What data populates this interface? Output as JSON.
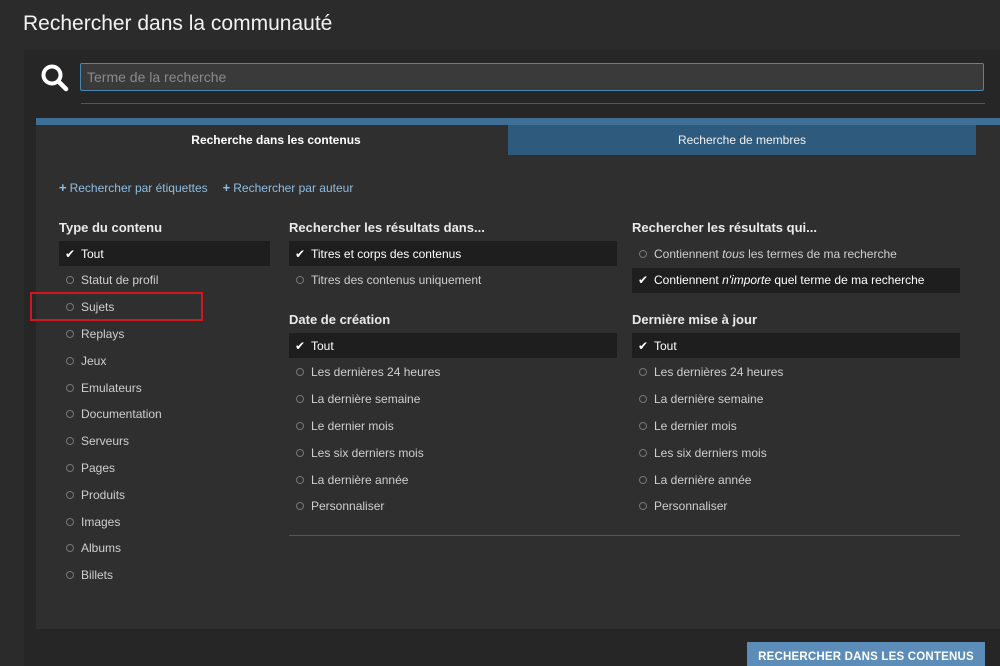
{
  "page": {
    "title": "Rechercher dans la communauté"
  },
  "search": {
    "placeholder": "Terme de la recherche",
    "value": ""
  },
  "tabs": [
    {
      "label": "Recherche dans les contenus",
      "active": true
    },
    {
      "label": "Recherche de membres",
      "active": false
    }
  ],
  "links": {
    "by_tags": "Rechercher par étiquettes",
    "by_author": "Rechercher par auteur"
  },
  "content_type": {
    "title": "Type du contenu",
    "items": [
      "Tout",
      "Statut de profil",
      "Sujets",
      "Replays",
      "Jeux",
      "Emulateurs",
      "Documentation",
      "Serveurs",
      "Pages",
      "Produits",
      "Images",
      "Albums",
      "Billets"
    ],
    "selected": "Tout"
  },
  "search_in": {
    "title": "Rechercher les résultats dans...",
    "items": [
      "Titres et corps des contenus",
      "Titres des contenus uniquement"
    ],
    "selected": "Titres et corps des contenus"
  },
  "match": {
    "title": "Rechercher les résultats qui...",
    "items": [
      {
        "before": "Contiennent ",
        "em": "tous",
        "after": " les termes de ma recherche"
      },
      {
        "before": "Contiennent ",
        "em": "n'importe",
        "after": " quel terme de ma recherche"
      }
    ],
    "selected_index": 1
  },
  "created": {
    "title": "Date de création",
    "items": [
      "Tout",
      "Les dernières 24 heures",
      "La dernière semaine",
      "Le dernier mois",
      "Les six derniers mois",
      "La dernière année",
      "Personnaliser"
    ],
    "selected": "Tout"
  },
  "updated": {
    "title": "Dernière mise à jour",
    "items": [
      "Tout",
      "Les dernières 24 heures",
      "La dernière semaine",
      "Le dernier mois",
      "Les six derniers mois",
      "La dernière année",
      "Personnaliser"
    ],
    "selected": "Tout"
  },
  "submit": {
    "label": "RECHERCHER DANS LES CONTENUS"
  },
  "colors": {
    "accent": "#3f6f95",
    "tab_inactive": "#2e5a7e",
    "link": "#8fbde0",
    "highlight": "#d0181c",
    "button": "#5b8db8"
  },
  "icons": {
    "search": "search-icon",
    "check": "check-icon",
    "radio": "radio-icon",
    "plus": "plus-icon"
  }
}
